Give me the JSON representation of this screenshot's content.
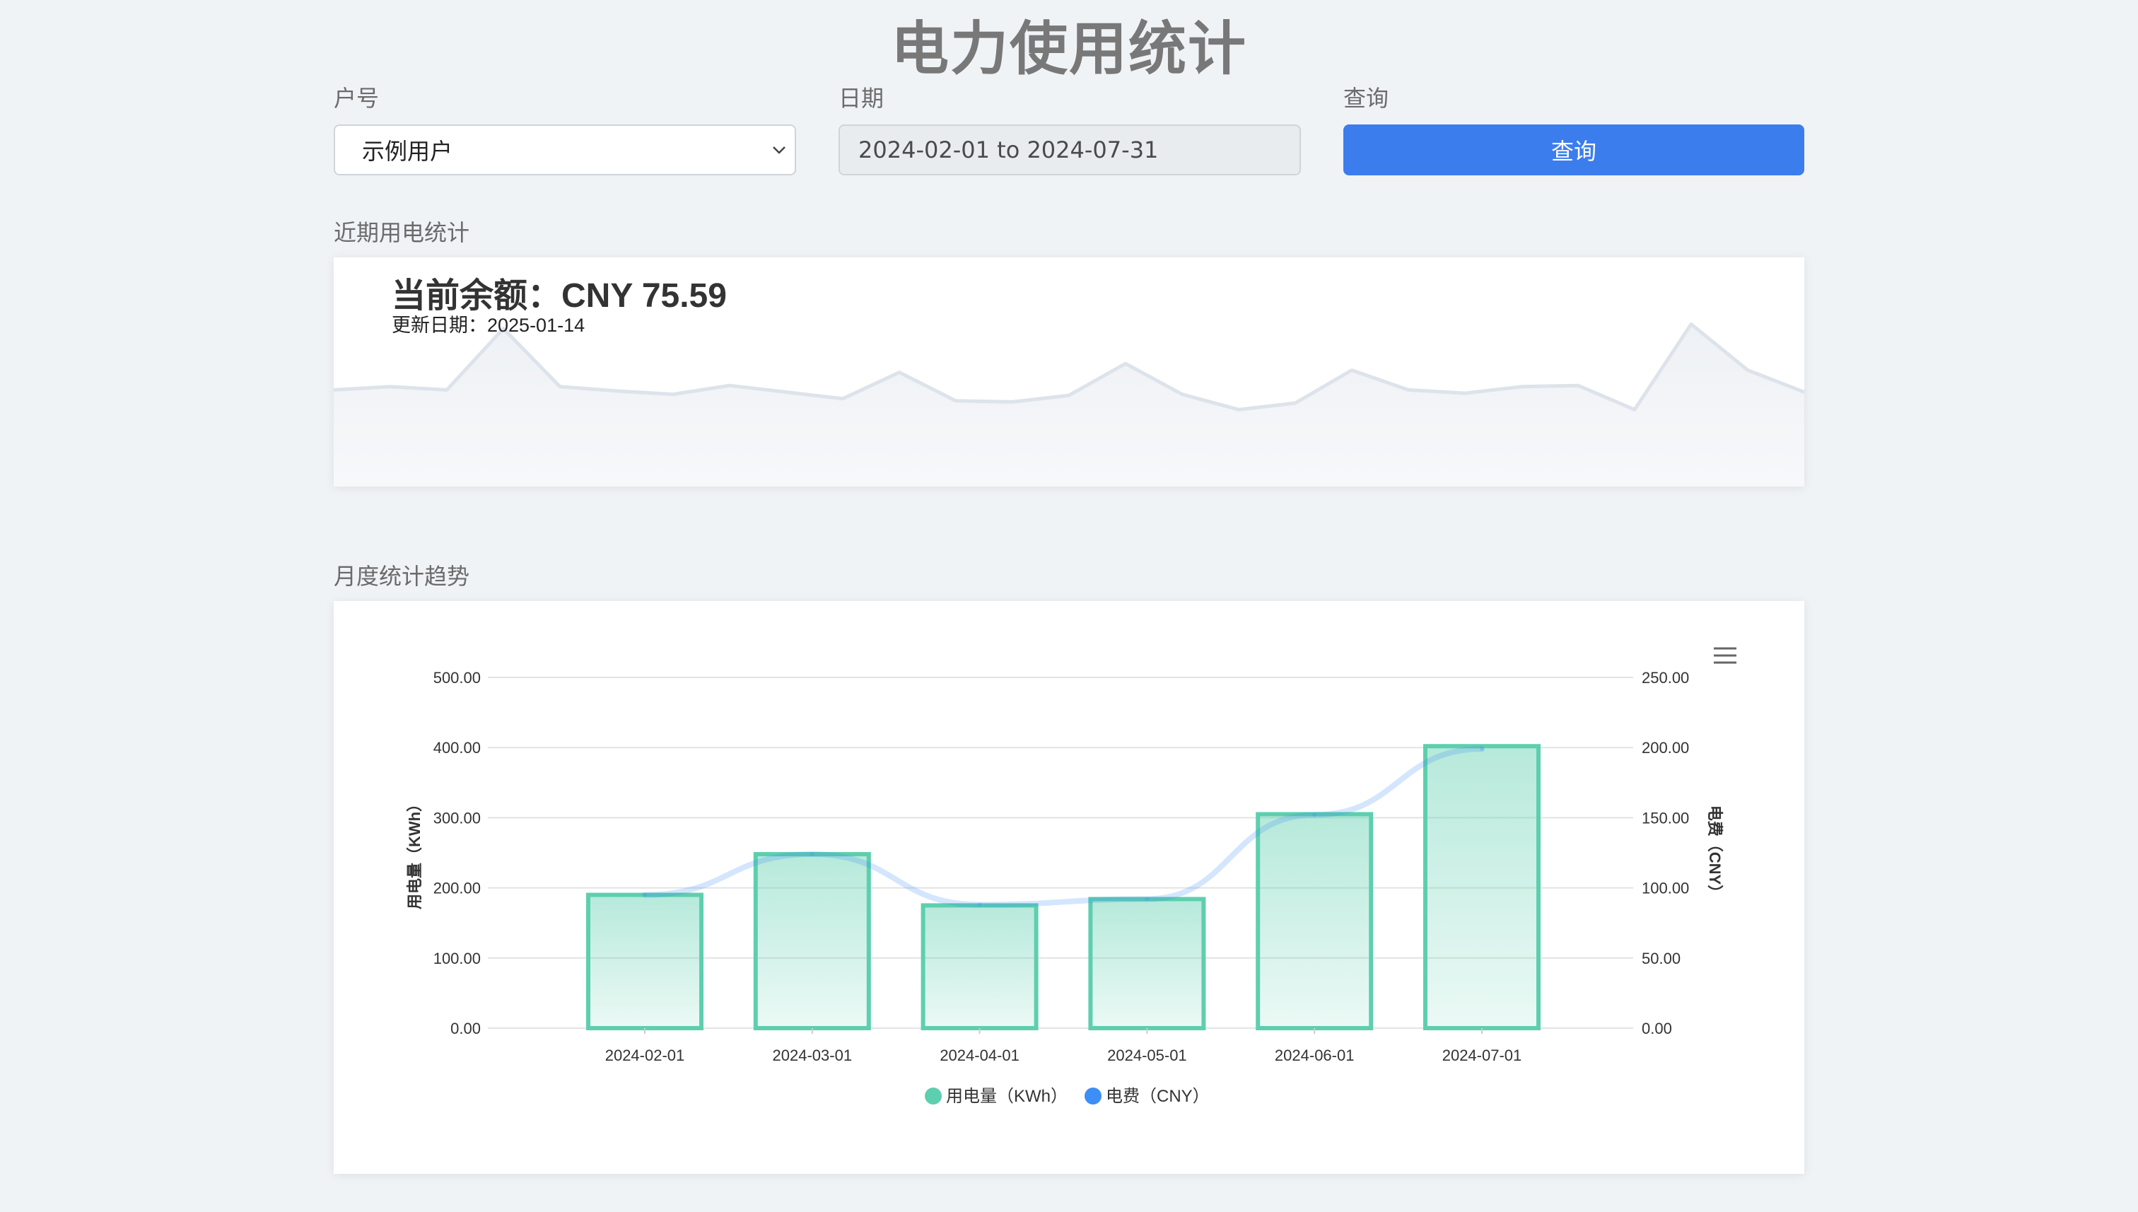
{
  "header": {
    "title": "电力使用统计"
  },
  "form": {
    "account_label": "户号",
    "account_value": "示例用户",
    "date_label": "日期",
    "date_value": "2024-02-01 to 2024-07-31",
    "query_label": "查询",
    "query_button": "查询"
  },
  "recent": {
    "section_title": "近期用电统计",
    "balance_text": "当前余额：CNY 75.59",
    "update_text": "更新日期：2025-01-14",
    "sparkline": [
      52,
      55,
      52,
      108,
      55,
      51,
      48,
      56,
      50,
      44,
      68,
      42,
      41,
      47,
      76,
      48,
      34,
      40,
      70,
      52,
      49,
      55,
      56,
      34,
      112,
      70,
      50
    ],
    "line_color": "#dde3ea"
  },
  "monthly": {
    "section_title": "月度统计趋势",
    "menu_icon": "hamburger-menu-icon"
  },
  "chart_data": {
    "type": "bar",
    "categories": [
      "2024-02-01",
      "2024-03-01",
      "2024-04-01",
      "2024-05-01",
      "2024-06-01",
      "2024-07-01"
    ],
    "series": [
      {
        "name": "用电量（KWh）",
        "type": "bar",
        "axis": "left",
        "values": [
          190,
          248,
          175,
          184,
          305,
          402
        ],
        "color": "#5ecfae"
      },
      {
        "name": "电费（CNY）",
        "type": "line",
        "axis": "right",
        "values": [
          95,
          124,
          88,
          92,
          152,
          199
        ],
        "color": "#3d8ef5"
      }
    ],
    "y_left": {
      "label": "用电量（KWh）",
      "min": 0,
      "max": 500,
      "ticks": [
        "0.00",
        "100.00",
        "200.00",
        "300.00",
        "400.00",
        "500.00"
      ]
    },
    "y_right": {
      "label": "电费（CNY）",
      "min": 0,
      "max": 250,
      "ticks": [
        "0.00",
        "50.00",
        "100.00",
        "150.00",
        "200.00",
        "250.00"
      ]
    },
    "grid": true,
    "legend_position": "bottom-center"
  }
}
